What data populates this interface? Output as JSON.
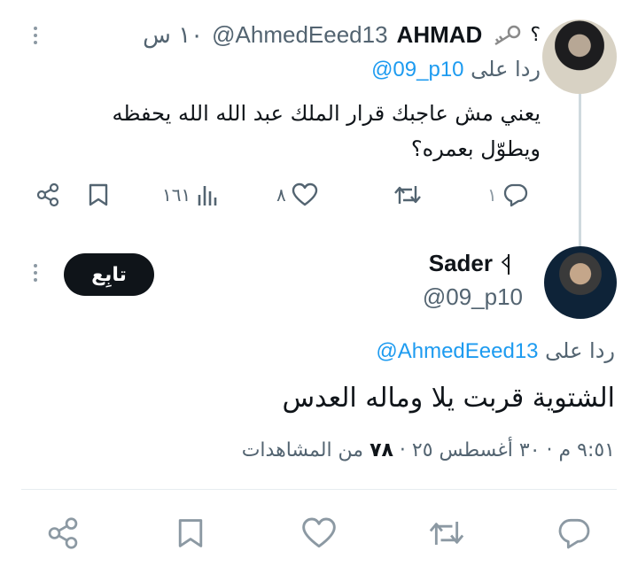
{
  "tweet1": {
    "name": "AHMAD",
    "handle": "@AhmedEeed13",
    "time": "١٠ س",
    "replying_prefix": "ردا على",
    "replying_to": "@09_p10",
    "text": "يعني مش عاجبك قرار الملك عبد الله الله يحفظه ويطوّل بعمره؟",
    "actions": {
      "views": "١٦١",
      "likes": "٨",
      "replies": "١"
    }
  },
  "tweet2": {
    "name": "Sader",
    "handle": "@09_p10",
    "follow_label": "تابِع",
    "replying_prefix": "ردا على",
    "replying_to": "@AhmedEeed13",
    "text": "الشتوية قربت يلا وماله العدس",
    "meta_time": "٩:٥١ م · ٣٠ أغسطس ٢٥ · ",
    "meta_views_count": "٧٨",
    "meta_views_label": " من المشاهدات"
  },
  "icons": {
    "share": "share-icon",
    "bookmark": "bookmark-icon",
    "views": "views-icon",
    "like": "heart-icon",
    "retweet": "retweet-icon",
    "reply": "reply-icon",
    "more": "more-icon",
    "key": "key-icon",
    "flag": "flag-icon"
  },
  "colors": {
    "accent": "#1d9bf0",
    "muted": "#536471",
    "text": "#0f1419",
    "thread_line": "#cfd9de"
  }
}
